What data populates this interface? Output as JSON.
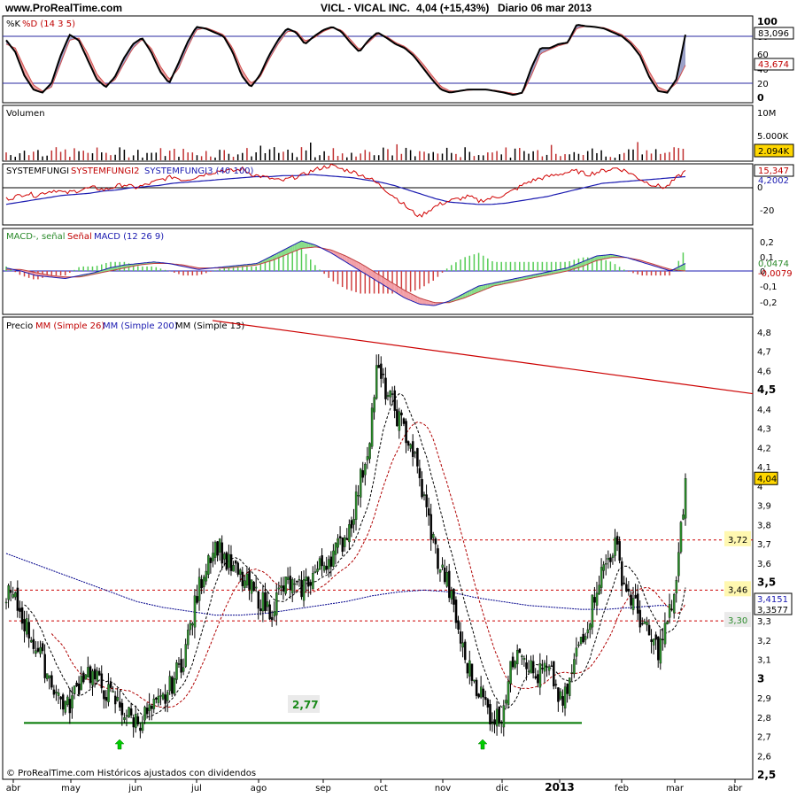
{
  "header": {
    "site": "www.ProRealTime.com",
    "title": "VICL - VICAL INC.",
    "price_change": "4,04 (+15,43%)",
    "period": "Diario  06 mar 2013"
  },
  "footer": {
    "source": "© ProRealTime.com Históricos ajustados con dividendos"
  },
  "colors": {
    "price_up": "#2a8a2a",
    "price_down": "#000000",
    "ma26": "#b00000",
    "ma200": "#00008b",
    "ma13": "#000000",
    "trend": "#cc0000",
    "support": "#007700",
    "arrow": "#00cc00",
    "macd_pos": "#55cc55",
    "macd_neg": "#d04040",
    "stoch_fill_up": "#9aa0c8",
    "stoch_fill_dn": "#f0a0a0"
  },
  "chart_data": [
    {
      "type": "line",
      "panel": "stochastic",
      "label": "%K %D (14 3 5)",
      "ylim": [
        0,
        100
      ],
      "y_ticks": [
        "100",
        "80",
        "60",
        "40",
        "20",
        "0"
      ],
      "levels": [
        80,
        20
      ],
      "series": [
        {
          "name": "%K",
          "values": [
            75,
            60,
            30,
            12,
            8,
            20,
            55,
            82,
            75,
            50,
            25,
            15,
            28,
            52,
            70,
            78,
            60,
            35,
            20,
            45,
            72,
            92,
            90,
            85,
            80,
            60,
            30,
            15,
            30,
            55,
            75,
            90,
            85,
            70,
            80,
            88,
            92,
            86,
            72,
            60,
            75,
            85,
            78,
            70,
            65,
            55,
            40,
            25,
            12,
            8,
            10,
            12,
            12,
            12,
            10,
            8,
            5,
            8,
            40,
            65,
            65,
            70,
            72,
            95,
            93,
            92,
            90,
            85,
            80,
            70,
            55,
            28,
            10,
            8,
            25,
            82
          ]
        },
        {
          "name": "%D",
          "values": [
            70,
            65,
            40,
            18,
            10,
            15,
            45,
            75,
            78,
            58,
            32,
            18,
            24,
            45,
            65,
            76,
            65,
            42,
            25,
            38,
            65,
            88,
            91,
            87,
            82,
            65,
            38,
            20,
            27,
            50,
            70,
            86,
            87,
            74,
            78,
            86,
            91,
            88,
            76,
            63,
            72,
            83,
            80,
            72,
            67,
            58,
            45,
            30,
            16,
            10,
            10,
            11,
            12,
            12,
            11,
            9,
            7,
            7,
            30,
            58,
            63,
            68,
            71,
            90,
            93,
            92,
            91,
            87,
            82,
            73,
            60,
            35,
            15,
            10,
            20,
            43
          ]
        }
      ],
      "last_values": [
        "83,096",
        "43,674"
      ]
    },
    {
      "type": "bar",
      "panel": "volume",
      "label": "Volumen",
      "y_ticks": [
        "10M",
        "5.000K"
      ],
      "last_value": "2.094K"
    },
    {
      "type": "line",
      "panel": "systemfungi",
      "label": "SYSTEMFUNGI SYSTEMFUNGI2 SYSTEMFUNGI3 (40 100)",
      "y_ticks": [
        "20",
        "0",
        "-20"
      ],
      "series": [
        {
          "name": "SYSTEMFUNGI2",
          "values": [
            -10,
            -8,
            -5,
            -7,
            -4,
            -2,
            -5,
            -3,
            -1,
            0,
            -2,
            1,
            3,
            0,
            2,
            5,
            8,
            10,
            7,
            9,
            12,
            14,
            16,
            15,
            17,
            12,
            10,
            8,
            6,
            9,
            11,
            15,
            18,
            20,
            17,
            15,
            12,
            8,
            2,
            -5,
            -12,
            -20,
            -26,
            -20,
            -15,
            -12,
            -10,
            -8,
            -12,
            -10,
            -8,
            -5,
            0,
            5,
            8,
            10,
            12,
            14,
            15,
            12,
            14,
            16,
            18,
            15,
            10,
            5,
            2,
            0,
            8,
            15
          ]
        },
        {
          "name": "SYSTEMFUNGI3",
          "values": [
            -15,
            -13,
            -11,
            -9,
            -7,
            -6,
            -5,
            -3,
            -2,
            0,
            1,
            2,
            4,
            5,
            6,
            7,
            8,
            9,
            10,
            10,
            11,
            11,
            12,
            11,
            10,
            9,
            7,
            5,
            2,
            -2,
            -6,
            -10,
            -13,
            -14,
            -15,
            -15,
            -14,
            -12,
            -10,
            -8,
            -5,
            -2,
            1,
            4,
            5,
            6,
            7,
            8,
            9,
            10
          ]
        }
      ],
      "last_values": [
        "15,347",
        "4,2002"
      ]
    },
    {
      "type": "line",
      "panel": "macd",
      "label": "MACD-, señal Señal MACD (12 26 9)",
      "y_ticks": [
        "0,2",
        "0,1",
        "0",
        "-0,1",
        "-0,2"
      ],
      "series": [
        {
          "name": "MACD",
          "values": [
            0.02,
            0.0,
            -0.03,
            -0.04,
            -0.05,
            -0.03,
            -0.01,
            0.02,
            0.04,
            0.05,
            0.06,
            0.05,
            0.03,
            0.01,
            0.02,
            0.03,
            0.04,
            0.05,
            0.1,
            0.15,
            0.2,
            0.17,
            0.12,
            0.06,
            0.0,
            -0.06,
            -0.12,
            -0.18,
            -0.22,
            -0.23,
            -0.2,
            -0.15,
            -0.1,
            -0.08,
            -0.06,
            -0.04,
            -0.02,
            0.0,
            0.02,
            0.06,
            0.1,
            0.11,
            0.09,
            0.06,
            0.03,
            0.0,
            0.05
          ]
        },
        {
          "name": "Señal",
          "values": [
            0.01,
            0.01,
            -0.01,
            -0.03,
            -0.04,
            -0.04,
            -0.02,
            0.0,
            0.02,
            0.04,
            0.05,
            0.05,
            0.04,
            0.02,
            0.02,
            0.02,
            0.03,
            0.04,
            0.07,
            0.11,
            0.15,
            0.16,
            0.14,
            0.1,
            0.05,
            -0.01,
            -0.07,
            -0.13,
            -0.18,
            -0.21,
            -0.21,
            -0.18,
            -0.14,
            -0.1,
            -0.08,
            -0.06,
            -0.04,
            -0.02,
            0.0,
            0.03,
            0.07,
            0.09,
            0.09,
            0.07,
            0.04,
            0.01,
            0.0
          ]
        }
      ],
      "last_values": [
        "0,0474",
        "-0,0079"
      ]
    },
    {
      "type": "line",
      "panel": "price",
      "label_parts": [
        "Precio",
        "MM (Simple 26)",
        "MM (Simple 200)",
        "MM (Simple 13)"
      ],
      "ylim": [
        2.5,
        4.9
      ],
      "y_ticks": [
        "4,8",
        "4,7",
        "4,6",
        "4,5",
        "4,4",
        "4,3",
        "4,2",
        "4,1",
        "4",
        "3,9",
        "3,8",
        "3,7",
        "3,6",
        "3,5",
        "3,4",
        "3,3",
        "3,2",
        "3,1",
        "3",
        "2,9",
        "2,8",
        "2,7",
        "2,6",
        "2,5"
      ],
      "x_labels": [
        "abr",
        "may",
        "jun",
        "jul",
        "ago",
        "sep",
        "oct",
        "nov",
        "dic",
        "2013",
        "feb",
        "mar",
        "abr"
      ],
      "close_series": [
        3.45,
        3.4,
        3.3,
        3.2,
        3.1,
        3.0,
        2.9,
        2.85,
        2.95,
        3.05,
        3.0,
        2.95,
        2.9,
        2.85,
        2.8,
        2.78,
        2.82,
        2.85,
        2.9,
        3.0,
        3.1,
        3.3,
        3.5,
        3.65,
        3.7,
        3.6,
        3.55,
        3.5,
        3.45,
        3.4,
        3.35,
        3.45,
        3.5,
        3.45,
        3.5,
        3.55,
        3.6,
        3.65,
        3.7,
        3.8,
        4.0,
        4.2,
        4.6,
        4.5,
        4.4,
        4.3,
        4.2,
        4.0,
        3.8,
        3.6,
        3.5,
        3.3,
        3.1,
        3.0,
        2.9,
        2.8,
        2.8,
        3.0,
        3.2,
        3.1,
        3.0,
        3.05,
        3.0,
        2.85,
        3.0,
        3.2,
        3.3,
        3.5,
        3.6,
        3.7,
        3.5,
        3.4,
        3.3,
        3.2,
        3.15,
        3.3,
        3.5,
        4.04
      ],
      "ma200_series": [
        3.65,
        3.6,
        3.55,
        3.5,
        3.45,
        3.4,
        3.37,
        3.35,
        3.33,
        3.33,
        3.34,
        3.36,
        3.38,
        3.4,
        3.43,
        3.45,
        3.46,
        3.45,
        3.42,
        3.4,
        3.38,
        3.37,
        3.36,
        3.36,
        3.37,
        3.38,
        3.38
      ],
      "trendline": [
        4.86,
        4.48
      ],
      "hlines": [
        {
          "value": 3.72,
          "label": "3,72"
        },
        {
          "value": 3.46,
          "label": "3,46"
        },
        {
          "value": 3.3,
          "label": "3,30"
        }
      ],
      "support": {
        "value": 2.77,
        "label": "2,77"
      },
      "last_values": [
        "4,04",
        "3,4151",
        "3,3577"
      ],
      "bold_ticks": [
        "4,5",
        "3,5",
        "3",
        "2,5"
      ]
    }
  ]
}
